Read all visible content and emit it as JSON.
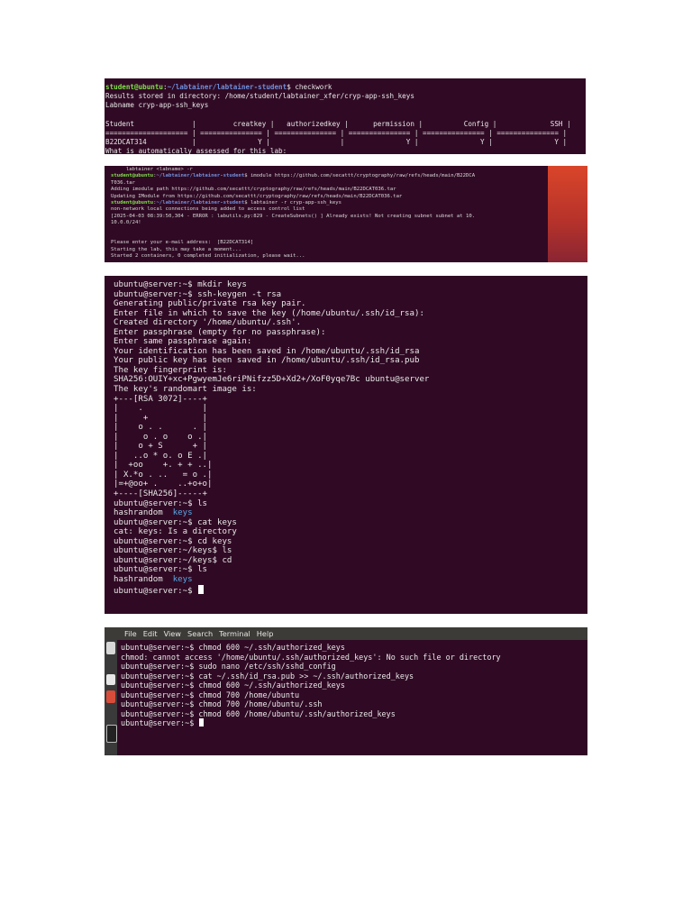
{
  "shot1": {
    "lines": [
      {
        "user": "student@ubuntu",
        "path": "~/labtainer/labtainer-student",
        "cmd": "$ checkwork"
      },
      {
        "text": "Results stored in directory: /home/student/labtainer_xfer/cryp-app-ssh_keys"
      },
      {
        "text": "Labname cryp-app-ssh_keys"
      },
      {
        "text": " "
      },
      {
        "text": "Student              |         creatkey |   authorizedkey |      permission |          Config |             SSH |"
      },
      {
        "text": "==================== | =============== | =============== | =============== | =============== | =============== |"
      },
      {
        "text": "B22DCAT314           |               Y |                 |               Y |               Y |               Y |"
      },
      {
        "text": "What is automatically assessed for this lab:"
      }
    ]
  },
  "shot2": {
    "lines": [
      {
        "text": "     labtainer <labname> -r"
      },
      {
        "user": "student@ubuntu",
        "path": "~/labtainer/labtainer-student",
        "cmd": "$ imodule https://github.com/secattt/cryptography/raw/refs/heads/main/B22DCA"
      },
      {
        "text": "T036.tar"
      },
      {
        "text": "Adding imodule path https://github.com/secattt/cryptography/raw/refs/heads/main/B22DCAT036.tar"
      },
      {
        "text": "Updating IModule from https://github.com/secattt/cryptography/raw/refs/heads/main/B22DCAT036.tar"
      },
      {
        "user": "student@ubuntu",
        "path": "~/labtainer/labtainer-student",
        "cmd": "$ labtainer -r cryp-app-ssh_keys"
      },
      {
        "text": "non-network local connections being added to access control list"
      },
      {
        "text": "[2025-04-03 08:39:50,304 - ERROR : labutils.py:829 - CreateSubnets() ] Already exists! Not creating subnet subnet at 10."
      },
      {
        "text": "10.0.0/24!"
      },
      {
        "text": " "
      },
      {
        "text": " "
      },
      {
        "text": "Please enter your e-mail address:  [B22DCAT314]"
      },
      {
        "text": "Starting the lab, this may take a moment..."
      },
      {
        "text": "Started 2 containers, 0 completed initialization, please wait..."
      }
    ]
  },
  "shot3": {
    "lines": [
      {
        "prompt": "ubuntu@server:~$",
        "cmd": " mkdir keys"
      },
      {
        "prompt": "ubuntu@server:~$",
        "cmd": " ssh-keygen -t rsa"
      },
      {
        "text": "Generating public/private rsa key pair."
      },
      {
        "text": "Enter file in which to save the key (/home/ubuntu/.ssh/id_rsa):"
      },
      {
        "text": "Created directory '/home/ubuntu/.ssh'."
      },
      {
        "text": "Enter passphrase (empty for no passphrase):"
      },
      {
        "text": "Enter same passphrase again:"
      },
      {
        "text": "Your identification has been saved in /home/ubuntu/.ssh/id_rsa"
      },
      {
        "text": "Your public key has been saved in /home/ubuntu/.ssh/id_rsa.pub"
      },
      {
        "text": "The key fingerprint is:"
      },
      {
        "text": "SHA256:OUIY+xc+PgwyemJe6riPNifzz5D+Xd2+/XoF0yqe7Bc ubuntu@server"
      },
      {
        "text": "The key's randomart image is:"
      },
      {
        "text": "+---[RSA 3072]----+"
      },
      {
        "text": "|    .            |"
      },
      {
        "text": "|     +           |"
      },
      {
        "text": "|    o . .      . |"
      },
      {
        "text": "|     o . o    o .|"
      },
      {
        "text": "|    o + S      + |"
      },
      {
        "text": "|   ..o * o. o E .|"
      },
      {
        "text": "|  +oo    +. + + ..|"
      },
      {
        "text": "| X.*o . ..   = o .|"
      },
      {
        "text": "|=+@oo+ .    ..+o+o|"
      },
      {
        "text": "+----[SHA256]-----+"
      },
      {
        "prompt": "ubuntu@server:~$",
        "cmd": " ls"
      },
      {
        "plain": "hashrandom  ",
        "dir": "keys"
      },
      {
        "prompt": "ubuntu@server:~$",
        "cmd": " cat keys"
      },
      {
        "text": "cat: keys: Is a directory"
      },
      {
        "prompt": "ubuntu@server:~$",
        "cmd": " cd keys"
      },
      {
        "prompt": "ubuntu@server:~/keys$",
        "cmd": " ls"
      },
      {
        "prompt": "ubuntu@server:~/keys$",
        "cmd": " cd"
      },
      {
        "prompt": "ubuntu@server:~$",
        "cmd": " ls"
      },
      {
        "plain": "hashrandom  ",
        "dir": "keys"
      },
      {
        "prompt": "ubuntu@server:~$",
        "cmd": " ",
        "cursor": true
      }
    ]
  },
  "shot4": {
    "menu": [
      "File",
      "Edit",
      "View",
      "Search",
      "Terminal",
      "Help"
    ],
    "lines": [
      {
        "prompt": "ubuntu@server:~$",
        "cmd": " chmod 600 ~/.ssh/authorized_keys"
      },
      {
        "text": "chmod: cannot access '/home/ubuntu/.ssh/authorized_keys': No such file or directory"
      },
      {
        "prompt": "ubuntu@server:~$",
        "cmd": " sudo nano /etc/ssh/sshd_config"
      },
      {
        "prompt": "ubuntu@server:~$",
        "cmd": " cat ~/.ssh/id_rsa.pub >> ~/.ssh/authorized_keys"
      },
      {
        "prompt": "ubuntu@server:~$",
        "cmd": " chmod 600 ~/.ssh/authorized_keys"
      },
      {
        "prompt": "ubuntu@server:~$",
        "cmd": " chmod 700 /home/ubuntu"
      },
      {
        "prompt": "ubuntu@server:~$",
        "cmd": " chmod 700 /home/ubuntu/.ssh"
      },
      {
        "prompt": "ubuntu@server:~$",
        "cmd": " chmod 600 /home/ubuntu/.ssh/authorized_keys"
      },
      {
        "prompt": "ubuntu@server:~$",
        "cmd": " ",
        "cursor": true
      }
    ]
  },
  "colors": {
    "terminal_bg": "#300a24",
    "user_green": "#7fe04a",
    "path_blue": "#6f8fdc",
    "dir_blue": "#5aa9e6"
  }
}
